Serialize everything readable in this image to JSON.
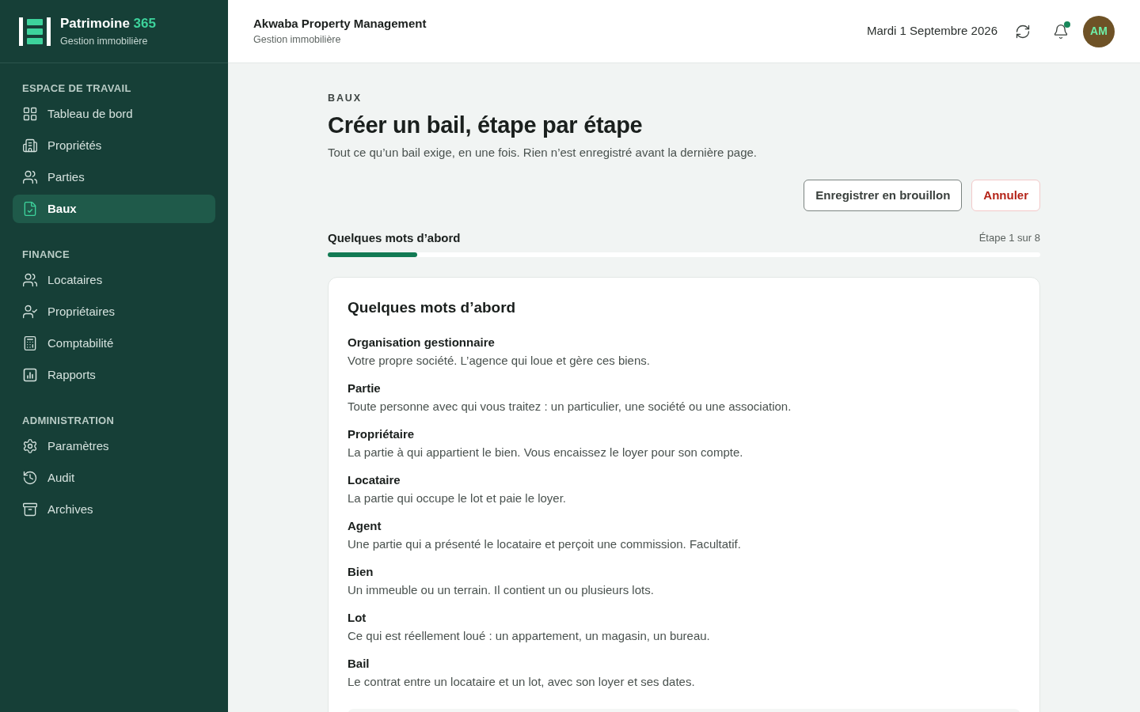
{
  "sidebar": {
    "brand": {
      "name": "Patrimoine",
      "suffix": "365",
      "tagline": "Gestion immobilière"
    },
    "sections": [
      {
        "title": "ESPACE DE TRAVAIL",
        "items": [
          {
            "label": "Tableau de bord",
            "selected": false
          },
          {
            "label": "Propriétés",
            "selected": false
          },
          {
            "label": "Parties",
            "selected": false
          },
          {
            "label": "Baux",
            "selected": true
          }
        ]
      },
      {
        "title": "FINANCE",
        "items": [
          {
            "label": "Locataires",
            "selected": false
          },
          {
            "label": "Propriétaires",
            "selected": false
          },
          {
            "label": "Comptabilité",
            "selected": false
          },
          {
            "label": "Rapports",
            "selected": false
          }
        ]
      },
      {
        "title": "ADMINISTRATION",
        "items": [
          {
            "label": "Paramètres",
            "selected": false
          },
          {
            "label": "Audit",
            "selected": false
          },
          {
            "label": "Archives",
            "selected": false
          }
        ]
      }
    ]
  },
  "header": {
    "organization": "Akwaba Property Management",
    "tagline": "Gestion immobilière",
    "date": "Mardi 1 Septembre 2026",
    "notifications": {
      "unread": true
    },
    "avatar": {
      "initials": "AM"
    }
  },
  "page": {
    "eyebrow": "BAUX",
    "title": "Créer un bail, étape par étape",
    "subtitle": "Tout ce qu’un bail exige, en une fois. Rien n’est enregistré avant la dernière page.",
    "actions": [
      {
        "label": "Enregistrer en brouillon",
        "kind": "secondary"
      },
      {
        "label": "Annuler",
        "kind": "danger"
      }
    ],
    "progress": {
      "label": "Quelques mots d’abord",
      "step": "Étape 1 sur 8",
      "level": 0.125
    },
    "card": {
      "title": "Quelques mots d’abord",
      "terms": [
        {
          "term": "Organisation gestionnaire",
          "definition": "Votre propre société. L’agence qui loue et gère ces biens."
        },
        {
          "term": "Partie",
          "definition": "Toute personne avec qui vous traitez : un particulier, une société ou une association."
        },
        {
          "term": "Propriétaire",
          "definition": "La partie à qui appartient le bien. Vous encaissez le loyer pour son compte."
        },
        {
          "term": "Locataire",
          "definition": "La partie qui occupe le lot et paie le loyer."
        },
        {
          "term": "Agent",
          "definition": "Une partie qui a présenté le locataire et perçoit une commission. Facultatif."
        },
        {
          "term": "Bien",
          "definition": "Un immeuble ou un terrain. Il contient un ou plusieurs lots."
        },
        {
          "term": "Lot",
          "definition": "Ce qui est réellement loué : un appartement, un magasin, un bureau."
        },
        {
          "term": "Bail",
          "definition": "Le contrat entre un locataire et un lot, avec son loyer et ses dates."
        }
      ]
    }
  }
}
